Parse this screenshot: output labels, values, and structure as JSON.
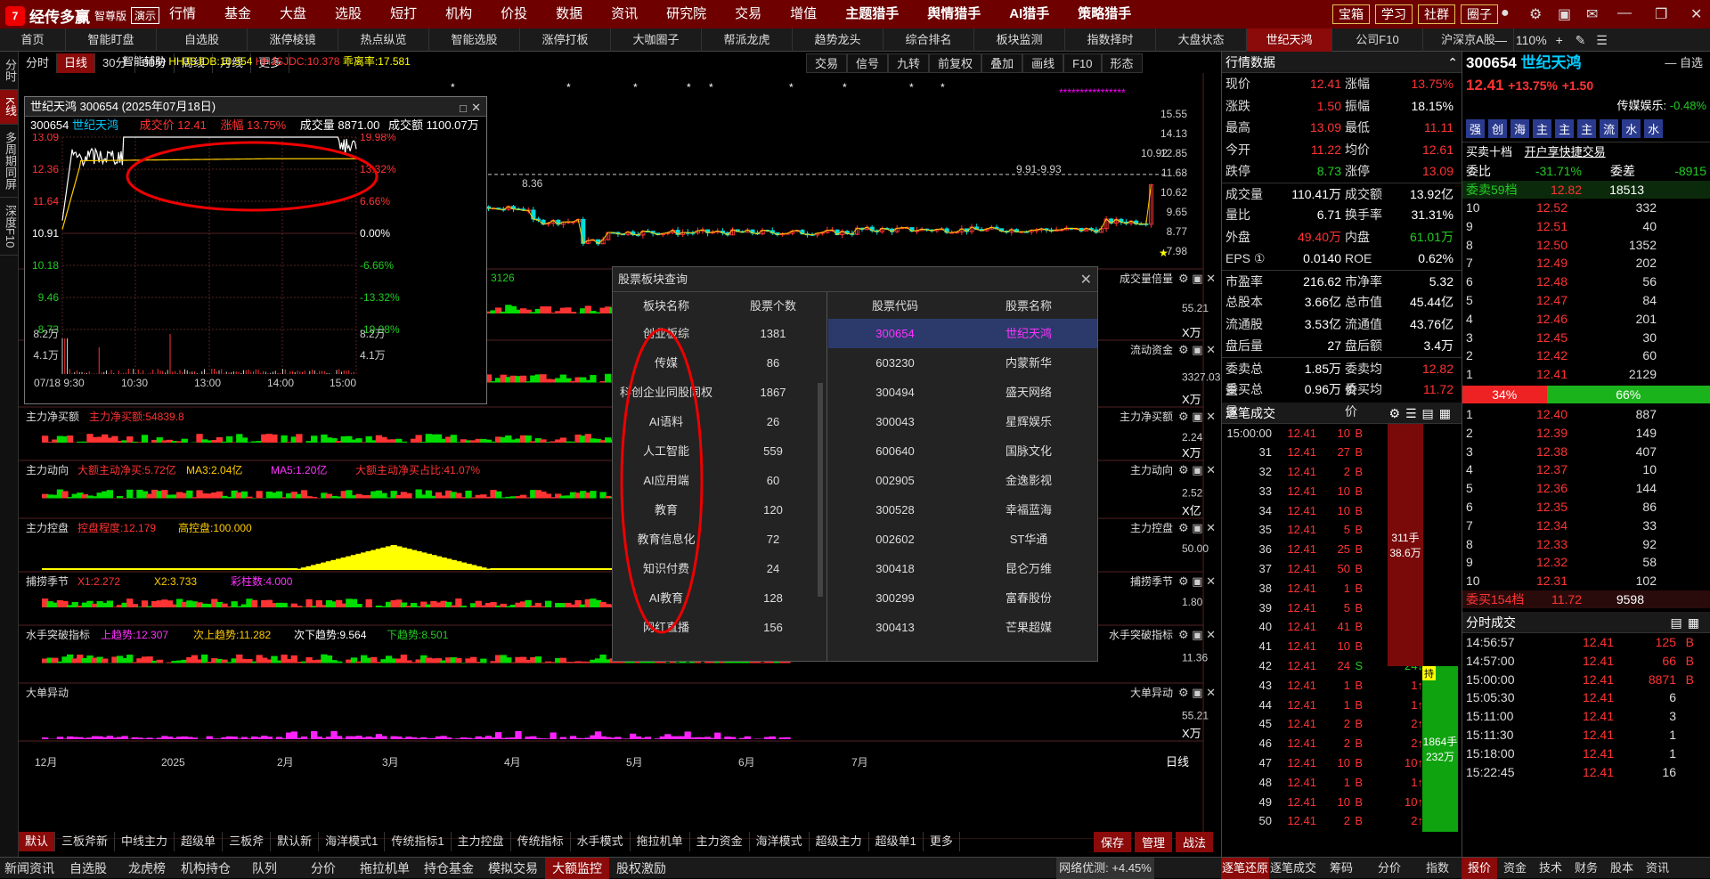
{
  "app": {
    "logo_mark": "7",
    "name": "经传多赢",
    "edition": "智尊版",
    "demo": "演示"
  },
  "menu": [
    "行情",
    "基金",
    "大盘",
    "选股",
    "短打",
    "机构",
    "价投",
    "数据",
    "资讯",
    "研究院",
    "交易",
    "增值",
    "主题猎手",
    "舆情猎手",
    "AI猎手",
    "策略猎手"
  ],
  "right_buttons": [
    "宝箱",
    "学习",
    "社群",
    "圈子"
  ],
  "tabs": [
    "首页",
    "智能盯盘",
    "自选股",
    "涨停棱镜",
    "热点纵览",
    "智能选股",
    "涨停打板",
    "大咖圈子",
    "帮派龙虎",
    "趋势龙头",
    "综合排名",
    "板块监测",
    "指数择时",
    "大盘状态",
    "世纪天鸿",
    "公司F10",
    "沪深京A股"
  ],
  "zoom": "110%",
  "left_side": [
    "分时",
    "K线",
    "多周期同屏",
    "深度F10"
  ],
  "periods": [
    "分时",
    "日线",
    "30分",
    "60分",
    "周线",
    "月线",
    "更多"
  ],
  "tools": [
    "交易",
    "信号",
    "九转",
    "前复权",
    "叠加",
    "画线",
    "F10",
    "形态"
  ],
  "indicator_line": {
    "label": "智能辅助",
    "a": "HHJSJDB:10.554",
    "b": "HHJSJDC:10.378",
    "c": "乖离率:17.581"
  },
  "popup": {
    "title": "世纪天鸿 300654 (2025年07月18日)",
    "code": "300654",
    "name": "世纪天鸿",
    "price": "成交价 12.41",
    "change": "涨幅 13.75%",
    "vol": "成交量 8871.00",
    "amt": "成交额 1100.07万",
    "left_ticks": [
      "13.09",
      "12.36",
      "11.64",
      "10.91",
      "10.18",
      "9.46",
      "8.73",
      "8.2万",
      "4.1万"
    ],
    "right_ticks": [
      "19.98%",
      "13.32%",
      "6.66%",
      "0.00%",
      "-6.66%",
      "-13.32%",
      "-19.98%",
      "8.2万",
      "4.1万"
    ],
    "time_ticks": [
      "07/18 9:30",
      "10:30",
      "13:00",
      "14:00",
      "15:00"
    ]
  },
  "kchart": {
    "right_ticks": [
      "15.55",
      "14.13",
      "12.85",
      "11.68",
      "10.62",
      "9.65",
      "8.77",
      "7.98"
    ],
    "labels": {
      "low": "8.36",
      "range": "9.91-9.93",
      "last": "10.92"
    },
    "month_ticks": [
      "12月",
      "2025",
      "2月",
      "3月",
      "4月",
      "5月",
      "6月",
      "7月"
    ],
    "axis_mode": "日线"
  },
  "subcharts": [
    {
      "title": "成交量倍量",
      "left": "",
      "right": "55.21",
      "unit": "X万",
      "extra": "3126"
    },
    {
      "title": "流动资金",
      "left": "",
      "right": "3327.03",
      "unit": "X万"
    },
    {
      "title": "主力净买额",
      "left": "主力净买额",
      "val": "主力净买额:54839.8",
      "right": "2.24",
      "unit": "X万"
    },
    {
      "title": "主力动向",
      "left": "主力动向",
      "val": "大额主动净买:5.72亿",
      "v2": "MA3:2.04亿",
      "v3": "MA5:1.20亿",
      "v4": "大额主动净买占比:41.07%",
      "right": "2.52",
      "unit": "X亿"
    },
    {
      "title": "主力控盘",
      "left": "主力控盘",
      "val": "控盘程度:12.179",
      "v2": "高控盘:100.000",
      "right": "50.00"
    },
    {
      "title": "捕捞季节",
      "left": "捕捞季节",
      "val": "X1:2.272",
      "v2": "X2:3.733",
      "v3": "彩柱数:4.000",
      "right": "1.80"
    },
    {
      "title": "水手突破指标",
      "left": "水手突破指标",
      "val": "上趋势:12.307",
      "v2": "次上趋势:11.282",
      "v3": "次下趋势:9.564",
      "v4": "下趋势:8.501",
      "right": "11.36"
    },
    {
      "title": "大单异动",
      "left": "大单异动",
      "right": "55.21",
      "unit": "X万"
    }
  ],
  "dialog": {
    "title": "股票板块查询",
    "h1": "板块名称",
    "h2": "股票个数",
    "h3": "股票代码",
    "h4": "股票名称",
    "sectors": [
      [
        "创业板综",
        "1381"
      ],
      [
        "传媒",
        "86"
      ],
      [
        "科创企业同股同权",
        "1867"
      ],
      [
        "AI语料",
        "26"
      ],
      [
        "人工智能",
        "559"
      ],
      [
        "AI应用端",
        "60"
      ],
      [
        "教育",
        "120"
      ],
      [
        "教育信息化",
        "72"
      ],
      [
        "知识付费",
        "24"
      ],
      [
        "AI教育",
        "128"
      ],
      [
        "网红直播",
        "156"
      ]
    ],
    "stocks": [
      [
        "300654",
        "世纪天鸿"
      ],
      [
        "603230",
        "内蒙新华"
      ],
      [
        "300494",
        "盛天网络"
      ],
      [
        "300043",
        "星辉娱乐"
      ],
      [
        "600640",
        "国脉文化"
      ],
      [
        "002905",
        "金逸影视"
      ],
      [
        "300528",
        "幸福蓝海"
      ],
      [
        "002602",
        "ST华通"
      ],
      [
        "300418",
        "昆仑万维"
      ],
      [
        "300299",
        "富春股份"
      ],
      [
        "300413",
        "芒果超媒"
      ]
    ]
  },
  "bottom_tabs": [
    "默认",
    "三板斧新",
    "中线主力",
    "超级单",
    "三板斧",
    "默认新",
    "海洋模式1",
    "传统指标1",
    "主力控盘",
    "传统指标",
    "水手模式",
    "拖拉机单",
    "主力资金",
    "海洋模式",
    "超级主力",
    "超级单1",
    "更多"
  ],
  "bottom_right": [
    "保存",
    "管理",
    "战法"
  ],
  "status": [
    "新闻资讯",
    "自选股",
    "龙虎榜",
    "机构持仓",
    "队列",
    "分价",
    "拖拉机单",
    "持仓基金",
    "模拟交易",
    "大额监控",
    "股权激励"
  ],
  "network": "网络优测:",
  "net_val": "+4.45%",
  "status_right": [
    "逐笔还原",
    "逐笔成交",
    "筹码",
    "分价",
    "指数"
  ],
  "status_far": [
    "报价",
    "资金",
    "技术",
    "财务",
    "股本",
    "资讯"
  ],
  "quote": {
    "title": "行情数据",
    "rows": [
      [
        "现价",
        "12.41",
        "red",
        "涨幅",
        "13.75%",
        "red"
      ],
      [
        "涨跌",
        "1.50",
        "red",
        "振幅",
        "18.15%",
        "white"
      ],
      [
        "最高",
        "13.09",
        "red",
        "最低",
        "11.11",
        "red"
      ],
      [
        "今开",
        "11.22",
        "red",
        "均价",
        "12.61",
        "red"
      ],
      [
        "跌停",
        "8.73",
        "green",
        "涨停",
        "13.09",
        "red"
      ],
      [
        "成交量",
        "110.41万",
        "white",
        "成交额",
        "13.92亿",
        "white"
      ],
      [
        "量比",
        "6.71",
        "white",
        "换手率",
        "31.31%",
        "white"
      ],
      [
        "外盘",
        "49.40万",
        "red",
        "内盘",
        "61.01万",
        "green"
      ],
      [
        "EPS ①",
        "0.0140",
        "white",
        "ROE",
        "0.62%",
        "white"
      ],
      [
        "市盈率",
        "216.62",
        "white",
        "市净率",
        "5.32",
        "white"
      ],
      [
        "总股本",
        "3.66亿",
        "white",
        "总市值",
        "45.44亿",
        "white"
      ],
      [
        "流通股",
        "3.53亿",
        "white",
        "流通值",
        "43.76亿",
        "white"
      ],
      [
        "盘后量",
        "27",
        "white",
        "盘后额",
        "3.4万",
        "white"
      ],
      [
        "委卖总量",
        "1.85万",
        "white",
        "委卖均价",
        "12.82",
        "red"
      ],
      [
        "委买总量",
        "0.96万",
        "white",
        "委买均价",
        "11.72",
        "red"
      ]
    ]
  },
  "ticks_title": "逐笔成交",
  "ticks": [
    [
      "15:00:00",
      "12.41",
      "10",
      "B"
    ],
    [
      "31",
      "12.41",
      "27",
      "B"
    ],
    [
      "32",
      "12.41",
      "2",
      "B"
    ],
    [
      "33",
      "12.41",
      "10",
      "B"
    ],
    [
      "34",
      "12.41",
      "10",
      "B"
    ],
    [
      "35",
      "12.41",
      "5",
      "B"
    ],
    [
      "36",
      "12.41",
      "25",
      "B"
    ],
    [
      "37",
      "12.41",
      "50",
      "B"
    ],
    [
      "38",
      "12.41",
      "1",
      "B"
    ],
    [
      "39",
      "12.41",
      "5",
      "B"
    ],
    [
      "40",
      "12.41",
      "41",
      "B"
    ],
    [
      "41",
      "12.41",
      "10",
      "B"
    ],
    [
      "42",
      "12.41",
      "24",
      "S"
    ],
    [
      "43",
      "12.41",
      "1",
      "B"
    ],
    [
      "44",
      "12.41",
      "1",
      "B"
    ],
    [
      "45",
      "12.41",
      "2",
      "B"
    ],
    [
      "46",
      "12.41",
      "2",
      "B"
    ],
    [
      "47",
      "12.41",
      "10",
      "B"
    ],
    [
      "48",
      "12.41",
      "1",
      "B"
    ],
    [
      "49",
      "12.41",
      "10",
      "B"
    ],
    [
      "50",
      "12.41",
      "2",
      "B"
    ]
  ],
  "tick_sums": [
    "10",
    "27",
    "2",
    "10",
    "10",
    "5",
    "25",
    "50",
    "1",
    "5",
    "41",
    "10",
    "24",
    "1",
    "1",
    "2",
    "2",
    "10",
    "1",
    "10",
    "2"
  ],
  "sell_bar": {
    "a": "311手",
    "b": "38.6万"
  },
  "buy_bar": {
    "tag": "持",
    "a": "1864手",
    "b": "232万"
  },
  "order": {
    "code": "300654",
    "name": "世纪天鸿",
    "price": "12.41",
    "chg": "+13.75%",
    "chg2": "+1.50",
    "entertain": "传媒娱乐:",
    "ent_val": "-0.48%",
    "self": "自选",
    "chips": [
      "强",
      "创",
      "海",
      "主",
      "主",
      "主",
      "流",
      "水",
      "水"
    ],
    "banner": "买卖十档",
    "banner2": "开户享快捷交易",
    "wb": "委比",
    "wbv": "-31.71%",
    "wc": "委差",
    "wcv": "-8915",
    "sell_total": "委卖59档",
    "sell_total_p": "12.82",
    "sell_total_v": "18513",
    "sells": [
      [
        "10",
        "12.52",
        "332"
      ],
      [
        "9",
        "12.51",
        "40"
      ],
      [
        "8",
        "12.50",
        "1352"
      ],
      [
        "7",
        "12.49",
        "202"
      ],
      [
        "6",
        "12.48",
        "56"
      ],
      [
        "5",
        "12.47",
        "84"
      ],
      [
        "4",
        "12.46",
        "201"
      ],
      [
        "3",
        "12.45",
        "30"
      ],
      [
        "2",
        "12.42",
        "60"
      ],
      [
        "1",
        "12.41",
        "2129"
      ]
    ],
    "ratio_sell": "34%",
    "ratio_buy": "66%",
    "buys": [
      [
        "1",
        "12.40",
        "887"
      ],
      [
        "2",
        "12.39",
        "149"
      ],
      [
        "3",
        "12.38",
        "407"
      ],
      [
        "4",
        "12.37",
        "10"
      ],
      [
        "5",
        "12.36",
        "144"
      ],
      [
        "6",
        "12.35",
        "86"
      ],
      [
        "7",
        "12.34",
        "33"
      ],
      [
        "8",
        "12.33",
        "92"
      ],
      [
        "9",
        "12.32",
        "58"
      ],
      [
        "10",
        "12.31",
        "102"
      ]
    ],
    "buy_total": "委买154档",
    "buy_total_p": "11.72",
    "buy_total_v": "9598",
    "min_title": "分时成交",
    "mins": [
      [
        "14:56:57",
        "12.41",
        "125",
        "B"
      ],
      [
        "14:57:00",
        "12.41",
        "66",
        "B"
      ],
      [
        "15:00:00",
        "12.41",
        "8871",
        "B"
      ],
      [
        "15:05:30",
        "12.41",
        "6",
        ""
      ],
      [
        "15:11:00",
        "12.41",
        "3",
        ""
      ],
      [
        "15:11:30",
        "12.41",
        "1",
        ""
      ],
      [
        "15:18:00",
        "12.41",
        "1",
        ""
      ],
      [
        "15:22:45",
        "12.41",
        "16",
        ""
      ]
    ]
  },
  "colors": {
    "up": "#ff3333",
    "down": "#22cc22",
    "accent": "#8b0a0a",
    "menu_bg": "#6e0000"
  }
}
